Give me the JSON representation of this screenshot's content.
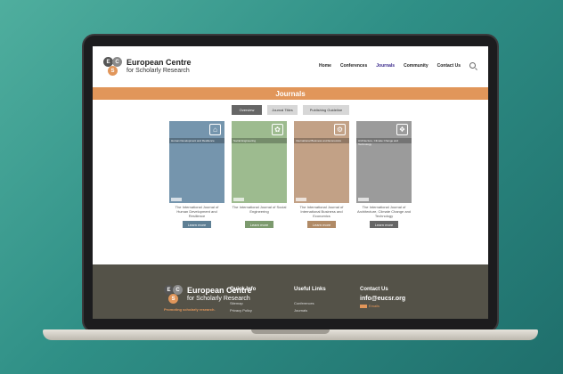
{
  "brand": {
    "mark": [
      "E",
      "C",
      "S"
    ],
    "name_line1": "European Centre",
    "name_line2": "for Scholarly Research"
  },
  "nav": {
    "items": [
      "Home",
      "Conferences",
      "Journals",
      "Community",
      "Contact Us"
    ],
    "active": "Journals"
  },
  "banner": {
    "title": "Journals"
  },
  "tabs": [
    "Overview",
    "Journal Titles",
    "Publishing Guideline"
  ],
  "journals": [
    {
      "cover_label": "Human Development and Resilience",
      "title": "The International Journal of Human Development and Resilience",
      "button": "Learn more",
      "color": "#7595ad",
      "btn": "#5e7f94",
      "icon": "⌂",
      "publisher": "European Centre"
    },
    {
      "cover_label": "Social Engineering",
      "title": "The International Journal of Social Engineering",
      "button": "Learn more",
      "color": "#9dbb8f",
      "btn": "#7c9a6e",
      "icon": "✿",
      "publisher": "European Centre"
    },
    {
      "cover_label": "International Business and Economics",
      "title": "The International Journal of International Business and Economics",
      "button": "Learn more",
      "color": "#c2a186",
      "btn": "#b08a66",
      "icon": "⚙",
      "publisher": "European Centre"
    },
    {
      "cover_label": "Architecture, Climate Change and Technology",
      "title": "The International Journal of Architecture, Climate Change and Technology",
      "button": "Learn more",
      "color": "#9b9b9b",
      "btn": "#666666",
      "icon": "❖",
      "publisher": "European Centre"
    }
  ],
  "footer": {
    "slogan": "Promoting scholarly research.",
    "quick_info": {
      "heading": "Quick Info",
      "links": [
        "Sitemap",
        "Privacy Policy"
      ]
    },
    "useful_links": {
      "heading": "Useful Links",
      "links": [
        "Conferences",
        "Journals"
      ]
    },
    "contact": {
      "heading": "Contact Us",
      "email": "info@eucsr.org",
      "social": "Emails"
    }
  }
}
